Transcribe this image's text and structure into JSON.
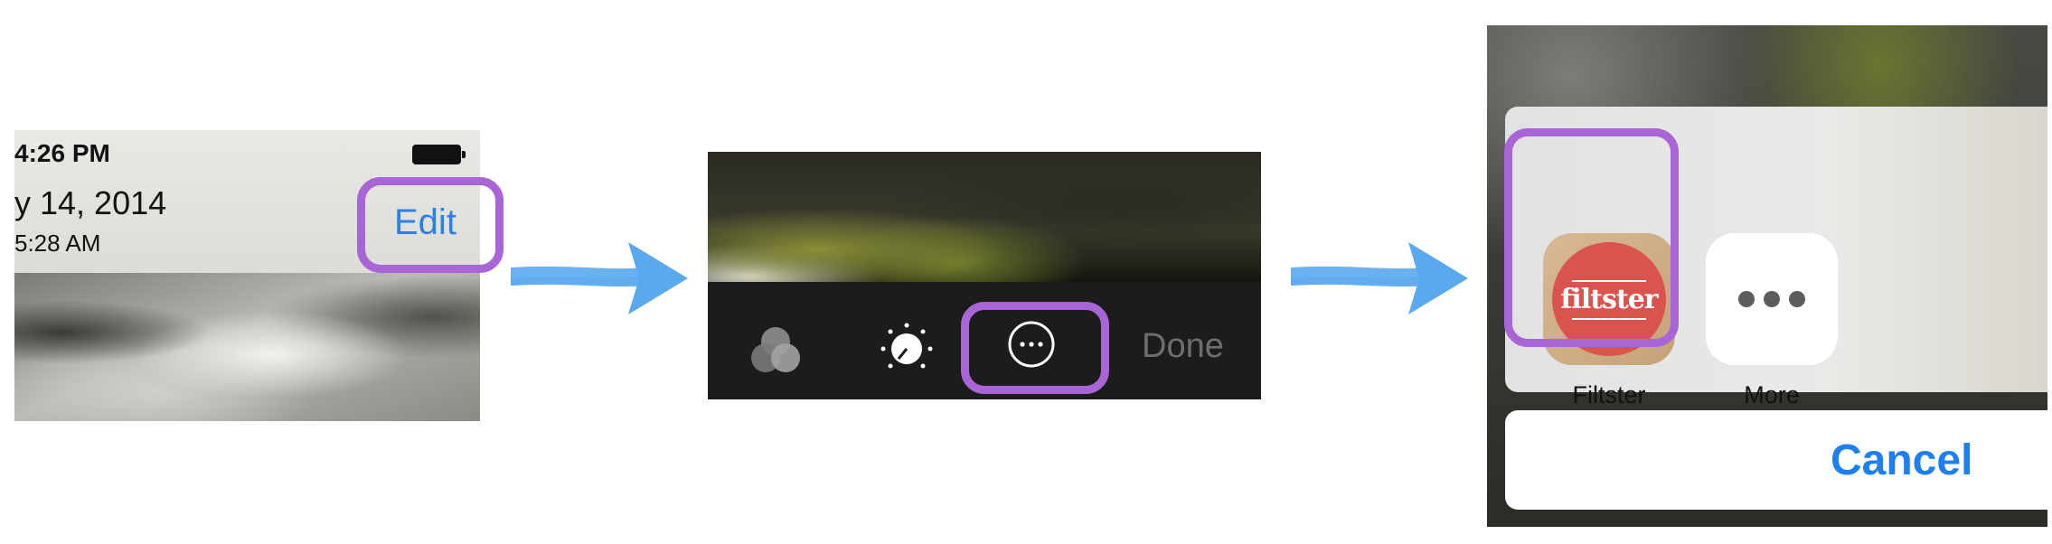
{
  "panel1": {
    "status_time": "4:26 PM",
    "date_text": "y 14, 2014",
    "clock_text": "5:28 AM",
    "edit_label": "Edit"
  },
  "panel2": {
    "tools": [
      {
        "name": "filters",
        "icon": "filters-icon"
      },
      {
        "name": "adjust",
        "icon": "dial-icon"
      },
      {
        "name": "more",
        "icon": "more-ellipsis-icon"
      }
    ],
    "done_label": "Done"
  },
  "panel3": {
    "apps": [
      {
        "label": "Filtster",
        "logo_text": "filtster",
        "icon": "filtster-app-icon"
      },
      {
        "label": "More",
        "icon": "more-dots-icon"
      }
    ],
    "cancel_label": "Cancel"
  },
  "colors": {
    "highlight": "#a765d6",
    "ios_blue": "#2f80e6",
    "arrow_blue": "#5aa9ef"
  }
}
